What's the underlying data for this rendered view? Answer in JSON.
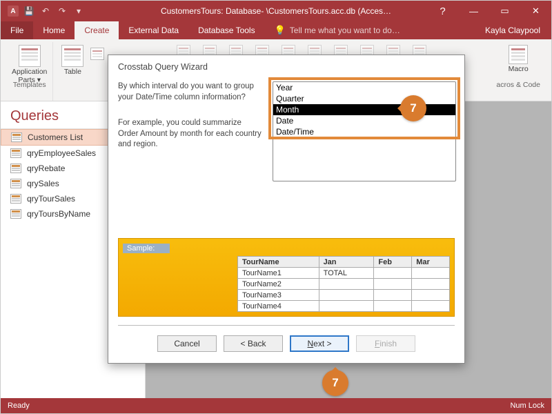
{
  "titlebar": {
    "title": "CustomersTours: Database- \\CustomersTours.acc.db (Acces…",
    "user": "Kayla Claypool",
    "qat": {
      "save": "💾",
      "undo": "↶",
      "redo": "↷"
    }
  },
  "tabs": {
    "file": "File",
    "home": "Home",
    "create": "Create",
    "external": "External Data",
    "dbtools": "Database Tools",
    "tellme": "Tell me what you want to do…"
  },
  "ribbon": {
    "groups": {
      "templates": "Templates",
      "macros": "acros & Code"
    },
    "app_parts": "Application\nParts ▾",
    "table": "Table",
    "macro": "Macro"
  },
  "nav": {
    "header": "Queries",
    "items": [
      "Customers List",
      "qryEmployeeSales",
      "qryRebate",
      "qrySales",
      "qryTourSales",
      "qryToursByName"
    ]
  },
  "dialog": {
    "title": "Crosstab Query Wizard",
    "prompt1": "By which interval do you want to group your Date/Time column information?",
    "prompt2": "For example, you could summarize Order Amount by month for each country and region.",
    "intervals": [
      "Year",
      "Quarter",
      "Month",
      "Date",
      "Date/Time"
    ],
    "selected_interval": "Month",
    "sample": {
      "label": "Sample:",
      "headers": [
        "TourName",
        "Jan",
        "Feb",
        "Mar"
      ],
      "rows": [
        "TourName1",
        "TourName2",
        "TourName3",
        "TourName4"
      ],
      "total": "TOTAL"
    },
    "buttons": {
      "cancel": "Cancel",
      "back": "< Back",
      "next_pre": "N",
      "next_mid": "ext >",
      "next_under": "N",
      "finish_pre": "F",
      "finish_mid": "inish"
    }
  },
  "status": {
    "ready": "Ready",
    "numlock": "Num Lock"
  },
  "callouts": {
    "b1": "7",
    "b2": "7"
  }
}
